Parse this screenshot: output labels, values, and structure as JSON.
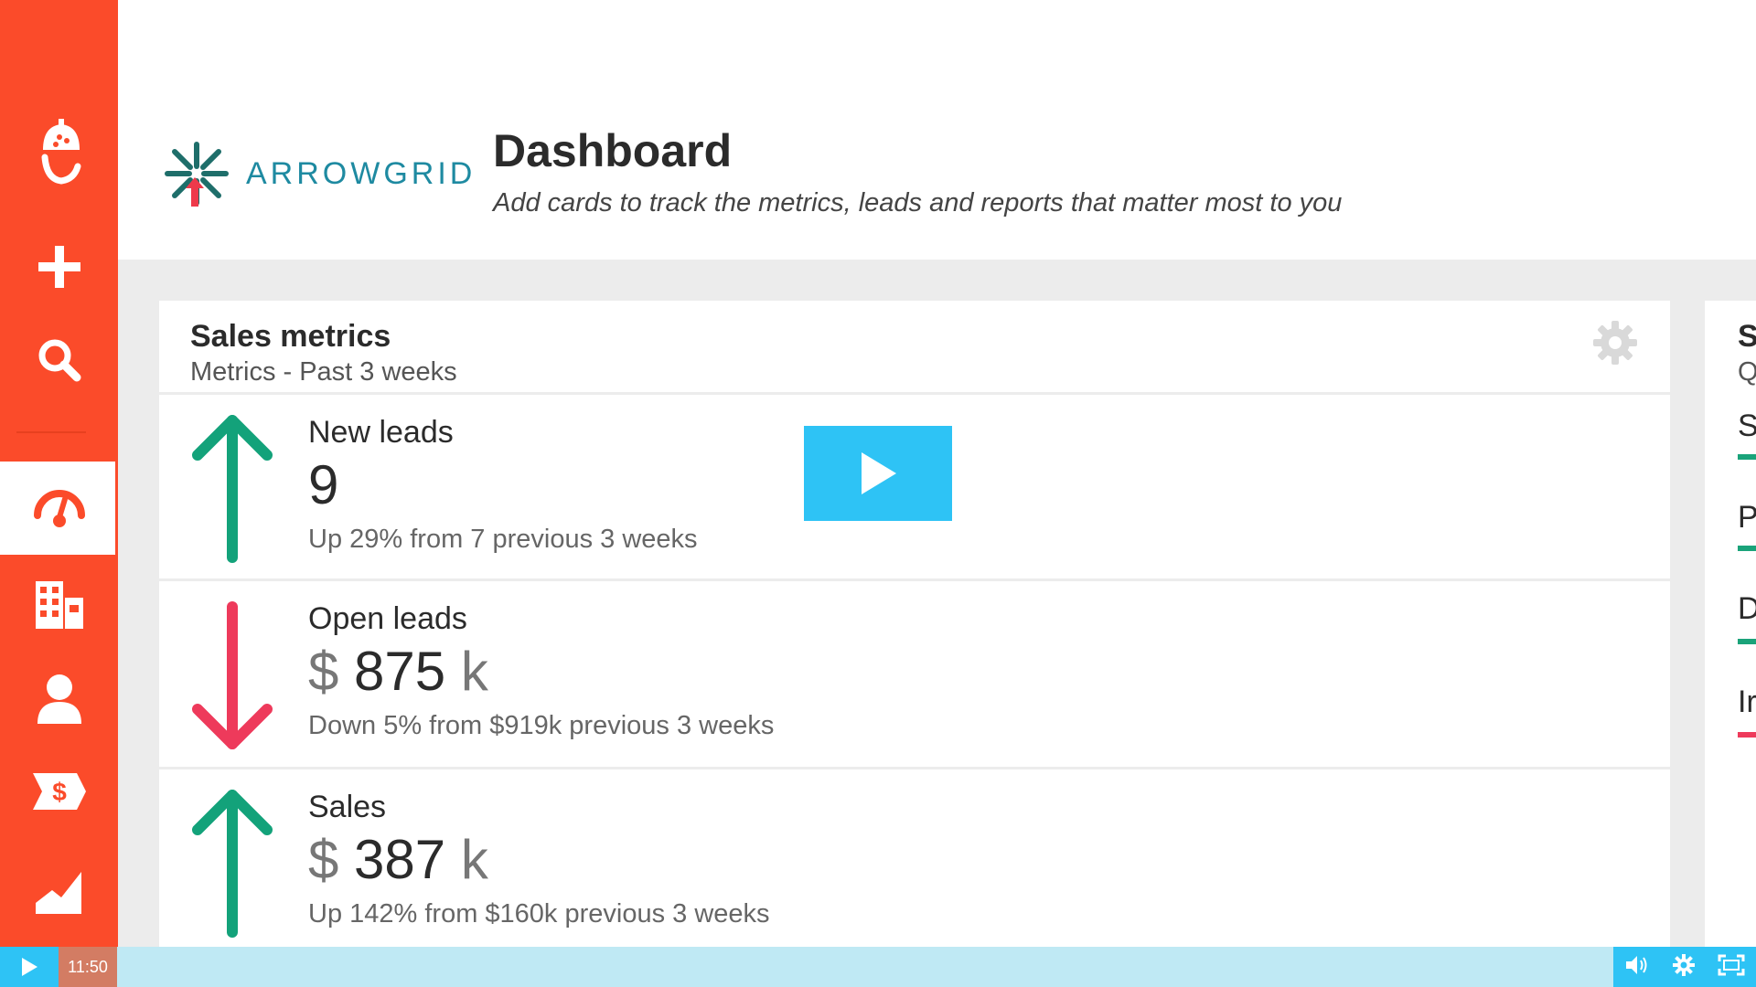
{
  "header": {
    "logo_text": "ARROWGRID",
    "title": "Dashboard",
    "subtitle": "Add cards to track the metrics, leads and reports that matter most to you"
  },
  "sidebar": {
    "items": [
      {
        "name": "acorn-icon"
      },
      {
        "name": "add-icon"
      },
      {
        "name": "search-icon"
      },
      {
        "name": "dashboard-gauge-icon",
        "active": true
      },
      {
        "name": "companies-icon"
      },
      {
        "name": "contacts-icon"
      },
      {
        "name": "deals-icon"
      },
      {
        "name": "reports-icon"
      }
    ]
  },
  "card": {
    "title": "Sales metrics",
    "subtitle": "Metrics - Past 3 weeks",
    "rows": [
      {
        "label": "New leads",
        "value": "9",
        "prefix": "",
        "suffix": "",
        "note": "Up 29% from 7 previous 3 weeks",
        "trend": "up"
      },
      {
        "label": "Open leads",
        "value": "875",
        "prefix": "$",
        "suffix": "k",
        "note": "Down 5% from $919k previous 3 weeks",
        "trend": "down"
      },
      {
        "label": "Sales",
        "value": "387",
        "prefix": "$",
        "suffix": "k",
        "note": "Up 142% from $160k previous 3 weeks",
        "trend": "up"
      }
    ]
  },
  "side_card": {
    "title": "S",
    "subtitle": "Q",
    "items": [
      {
        "label": "S",
        "color": "#1aa37a"
      },
      {
        "label": "P",
        "color": "#1aa37a"
      },
      {
        "label": "D",
        "color": "#1aa37a"
      },
      {
        "label": "Ir",
        "color": "#ee3a5b"
      }
    ]
  },
  "colors": {
    "sidebar": "#fb4b2a",
    "up": "#13a27a",
    "down": "#ee3a5b",
    "player": "#2ec3f5"
  },
  "player": {
    "time": "11:50"
  }
}
